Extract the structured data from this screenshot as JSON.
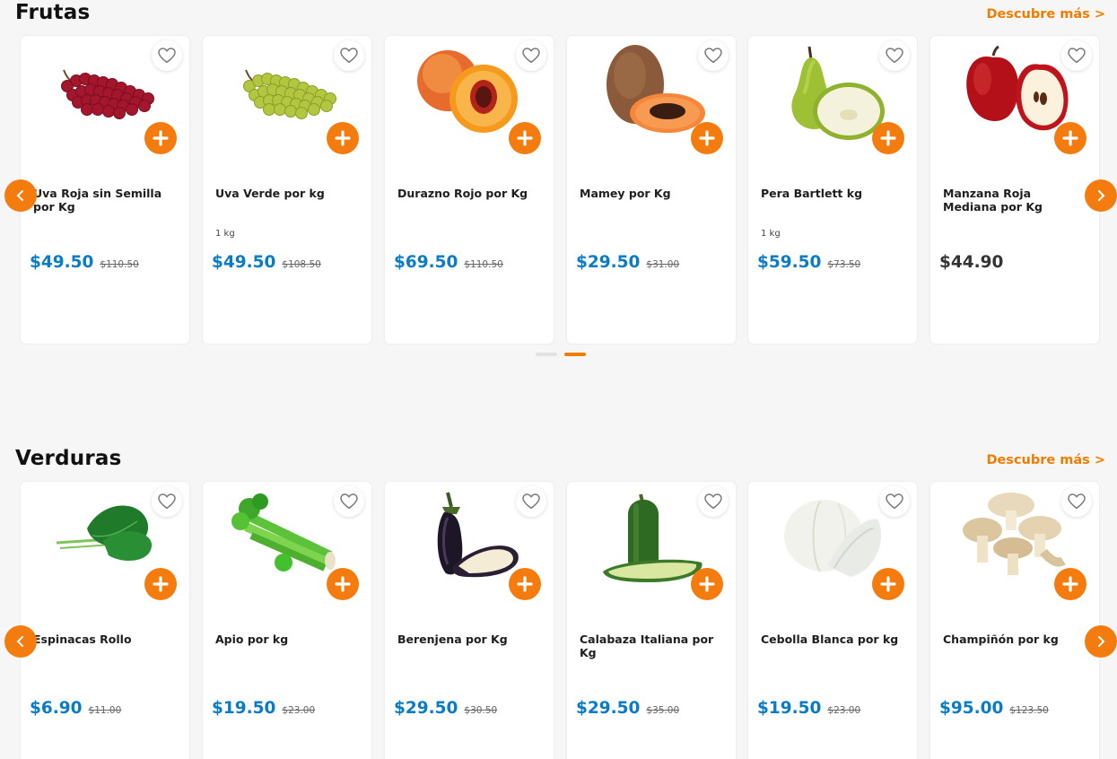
{
  "colors": {
    "accent": "#f47c0e",
    "price": "#0a7cc6",
    "background": "#f6f6f6"
  },
  "sections": [
    {
      "title": "Frutas",
      "more": "Descubre más >",
      "products": [
        {
          "name": "Uva Roja sin Semilla por Kg",
          "unit": "",
          "price": "$49.50",
          "old_price": "$110.50",
          "image": "red-grapes"
        },
        {
          "name": "Uva Verde por kg",
          "unit": "1 kg",
          "price": "$49.50",
          "old_price": "$108.50",
          "image": "green-grapes"
        },
        {
          "name": "Durazno Rojo por Kg",
          "unit": "",
          "price": "$69.50",
          "old_price": "$110.50",
          "image": "peach"
        },
        {
          "name": "Mamey por Kg",
          "unit": "",
          "price": "$29.50",
          "old_price": "$31.00",
          "image": "mamey"
        },
        {
          "name": "Pera Bartlett kg",
          "unit": "1 kg",
          "price": "$59.50",
          "old_price": "$73.50",
          "image": "pear"
        },
        {
          "name": "Manzana Roja Mediana por Kg",
          "unit": "",
          "price": "$44.90",
          "old_price": "",
          "image": "red-apple"
        }
      ]
    },
    {
      "title": "Verduras",
      "more": "Descubre más >",
      "products": [
        {
          "name": "Espinacas Rollo",
          "unit": "",
          "price": "$6.90",
          "old_price": "$11.00",
          "image": "spinach"
        },
        {
          "name": "Apio por kg",
          "unit": "",
          "price": "$19.50",
          "old_price": "$23.00",
          "image": "celery"
        },
        {
          "name": "Berenjena por Kg",
          "unit": "",
          "price": "$29.50",
          "old_price": "$30.50",
          "image": "eggplant"
        },
        {
          "name": "Calabaza Italiana por Kg",
          "unit": "",
          "price": "$29.50",
          "old_price": "$35.00",
          "image": "zucchini"
        },
        {
          "name": "Cebolla Blanca por kg",
          "unit": "",
          "price": "$19.50",
          "old_price": "$23.00",
          "image": "white-onion"
        },
        {
          "name": "Champiñón por kg",
          "unit": "",
          "price": "$95.00",
          "old_price": "$123.50",
          "image": "mushrooms"
        }
      ]
    }
  ],
  "carousel": {
    "pages": 2,
    "active_page": 2
  },
  "icons": {
    "favorite": "heart-icon",
    "add": "plus-icon",
    "prev": "chevron-left-icon",
    "next": "chevron-right-icon"
  }
}
